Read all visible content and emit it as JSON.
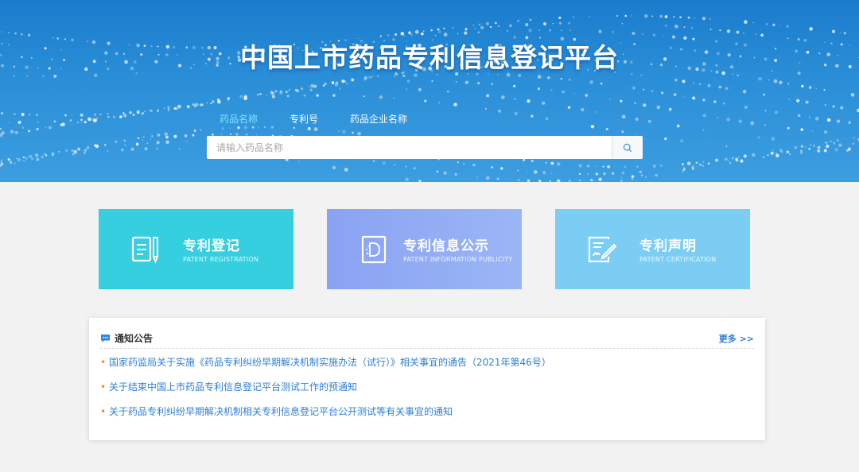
{
  "banner": {
    "title": "中国上市药品专利信息登记平台",
    "colors": {
      "top": "#1a7ccc",
      "bottom": "#3c9ee0"
    }
  },
  "search": {
    "tabs": [
      {
        "label": "药品名称",
        "active": true
      },
      {
        "label": "专利号",
        "active": false
      },
      {
        "label": "药品企业名称",
        "active": false
      }
    ],
    "placeholder": "请输入药品名称",
    "button_icon": "search-icon"
  },
  "cards": [
    {
      "title": "专利登记",
      "subtitle": "PATENT REGISTRATION",
      "icon": "document-pen-icon",
      "color": "#36cfe0"
    },
    {
      "title": "专利信息公示",
      "subtitle": "PATENT INFORMATION PUBLICITY",
      "icon": "publicity-icon",
      "color": "#8aa2f2"
    },
    {
      "title": "专利声明",
      "subtitle": "PATENT CERTIFICATION",
      "icon": "signature-icon",
      "color": "#7ccdf4"
    }
  ],
  "notice": {
    "title": "通知公告",
    "icon": "chat-bubble-icon",
    "more_label": "更多 >>",
    "items": [
      "国家药监局关于实施《药品专利纠纷早期解决机制实施办法（试行）》相关事宜的通告（2021年第46号）",
      "关于结束中国上市药品专利信息登记平台测试工作的预通知",
      "关于药品专利纠纷早期解决机制相关专利信息登记平台公开测试等有关事宜的通知"
    ],
    "link_color": "#2f7fd4",
    "bullet_color": "#f08c2e"
  }
}
